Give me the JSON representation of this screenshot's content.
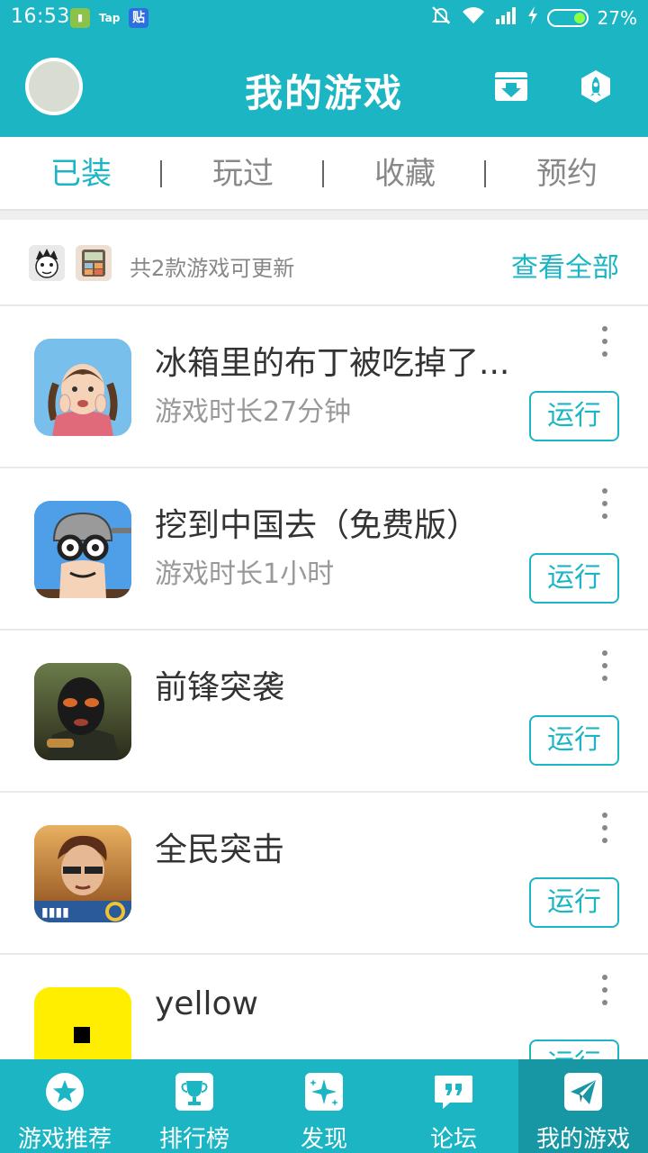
{
  "status_bar": {
    "time": "16:53",
    "apps": [
      "Tap",
      "贴"
    ],
    "battery": "27%"
  },
  "header": {
    "title": "我的游戏"
  },
  "tabs": [
    {
      "label": "已装",
      "active": true
    },
    {
      "label": "玩过",
      "active": false
    },
    {
      "label": "收藏",
      "active": false
    },
    {
      "label": "预约",
      "active": false
    }
  ],
  "update_bar": {
    "text": "共2款游戏可更新",
    "view_all": "查看全部"
  },
  "games": [
    {
      "name": "冰箱里的布丁被吃掉了...",
      "playtime": "游戏时长27分钟",
      "action": "运行"
    },
    {
      "name": "挖到中国去（免费版）",
      "playtime": "游戏时长1小时",
      "action": "运行"
    },
    {
      "name": "前锋突袭",
      "playtime": "",
      "action": "运行"
    },
    {
      "name": "全民突击",
      "playtime": "",
      "action": "运行"
    },
    {
      "name": "yellow",
      "playtime": "",
      "action": "运行"
    }
  ],
  "bottom_nav": [
    {
      "label": "游戏推荐",
      "icon": "star-icon",
      "active": false
    },
    {
      "label": "排行榜",
      "icon": "trophy-icon",
      "active": false
    },
    {
      "label": "发现",
      "icon": "sparkle-icon",
      "active": false
    },
    {
      "label": "论坛",
      "icon": "quote-chat-icon",
      "active": false
    },
    {
      "label": "我的游戏",
      "icon": "paper-plane-icon",
      "active": true
    }
  ],
  "colors": {
    "accent": "#1bb5c4",
    "accent_dark": "#1796a3"
  }
}
